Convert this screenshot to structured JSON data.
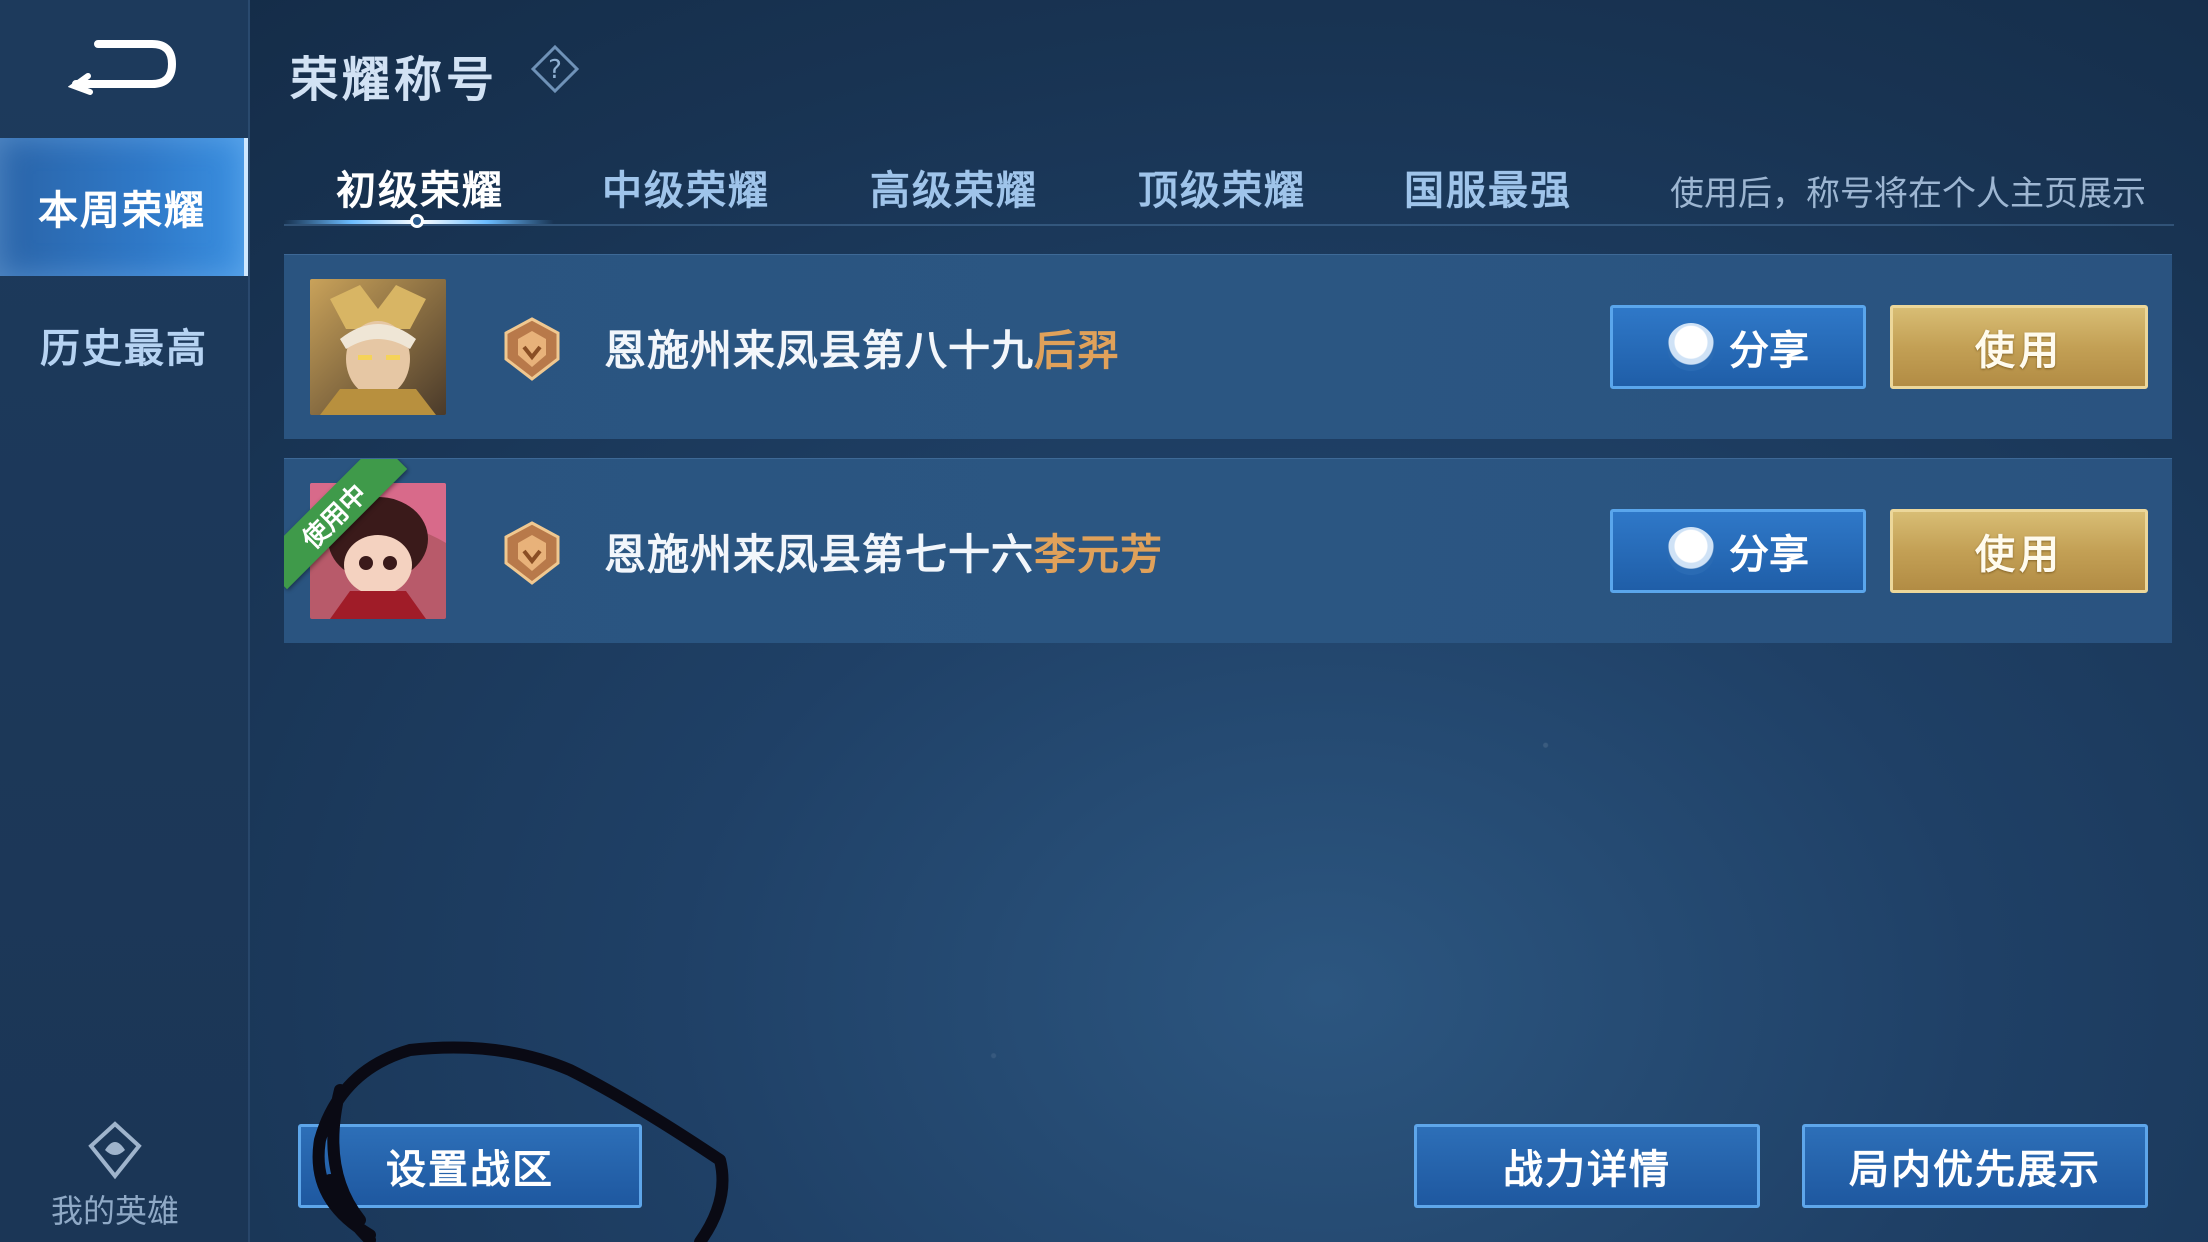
{
  "header": {
    "title": "荣耀称号"
  },
  "sidebar": {
    "items": [
      {
        "label": "本周荣耀",
        "active": true
      },
      {
        "label": "历史最高",
        "active": false
      }
    ],
    "bottom_label": "我的英雄"
  },
  "tabs": [
    {
      "label": "初级荣耀",
      "active": true
    },
    {
      "label": "中级荣耀",
      "active": false
    },
    {
      "label": "高级荣耀",
      "active": false
    },
    {
      "label": "顶级荣耀",
      "active": false
    },
    {
      "label": "国服最强",
      "active": false
    }
  ],
  "hint": "使用后，称号将在个人主页展示",
  "titles": [
    {
      "prefix": "恩施州来凤县第八十九",
      "hero": "后羿",
      "share_label": "分享",
      "use_label": "使用",
      "in_use": false
    },
    {
      "prefix": "恩施州来凤县第七十六",
      "hero": "李元芳",
      "share_label": "分享",
      "use_label": "使用",
      "in_use": true,
      "in_use_label": "使用中"
    }
  ],
  "bottom_buttons": {
    "set_zone": "设置战区",
    "power_details": "战力详情",
    "priority_display": "局内优先展示"
  },
  "colors": {
    "hero_name": "#e0a15a",
    "use_button": "#c3a055",
    "share_button": "#1f5ea8",
    "in_use_ribbon": "#3f9a4a"
  },
  "icons": [
    "back-arrow-icon",
    "help-icon",
    "rank-badge-icon",
    "qq-icon",
    "my-hero-emblem-icon"
  ]
}
